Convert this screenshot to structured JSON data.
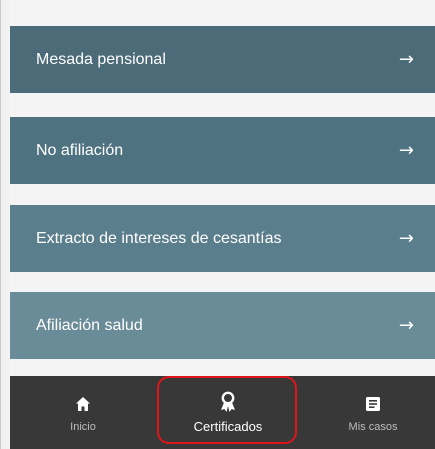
{
  "certificate_list": {
    "items": [
      {
        "label": "Mesada pensional",
        "arrow": "→"
      },
      {
        "label": "No afiliación",
        "arrow": "→"
      },
      {
        "label": "Extracto de intereses de cesantías",
        "arrow": "→"
      },
      {
        "label": "Afiliación salud",
        "arrow": "→"
      }
    ]
  },
  "bottom_nav": {
    "items": [
      {
        "label": "Inicio",
        "icon": "home-icon"
      },
      {
        "label": "Certificados",
        "icon": "certificate-icon",
        "active": true
      },
      {
        "label": "Mis casos",
        "icon": "cases-icon"
      }
    ]
  },
  "colors": {
    "card_1": "#4b6b79",
    "card_2": "#4f7280",
    "card_3": "#5b7e8c",
    "card_4": "#6a8b98",
    "nav_background": "#383838",
    "highlight": "#e0141b"
  }
}
